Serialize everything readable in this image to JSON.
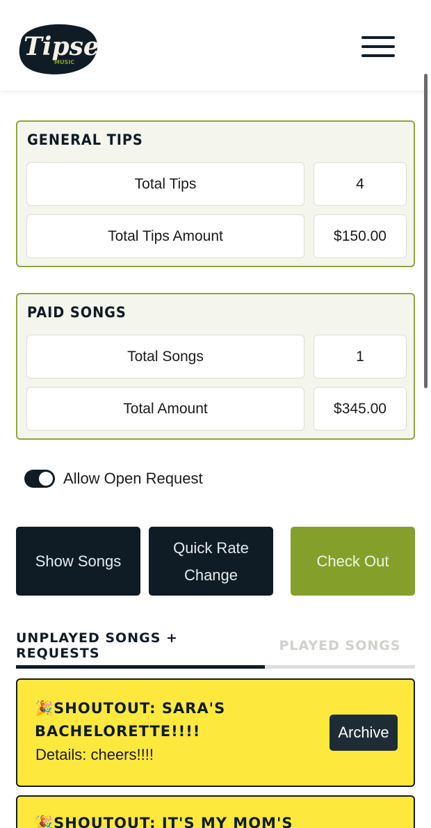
{
  "header": {
    "logo_text": "Tipsee",
    "logo_subtext": "MUSIC",
    "menu_icon": "hamburger-menu-icon"
  },
  "general_tips": {
    "title": "GENERAL TIPS",
    "rows": [
      {
        "label": "Total Tips",
        "value": "4"
      },
      {
        "label": "Total Tips Amount",
        "value": "$150.00"
      }
    ]
  },
  "paid_songs": {
    "title": "PAID SONGS",
    "rows": [
      {
        "label": "Total Songs",
        "value": "1"
      },
      {
        "label": "Total Amount",
        "value": "$345.00"
      }
    ]
  },
  "open_request": {
    "label": "Allow Open Request",
    "enabled": true
  },
  "actions": {
    "show_songs": "Show Songs",
    "quick_rate_line1": "Quick Rate",
    "quick_rate_line2": "Change",
    "check_out": "Check Out"
  },
  "tabs": {
    "unplayed": "UNPLAYED SONGS + REQUESTS",
    "played": "PLAYED SONGS"
  },
  "requests": [
    {
      "emoji": "🎉",
      "title_line1": "SHOUTOUT: SARA'S",
      "title_line2": "BACHELORETTE!!!!",
      "details": "Details: cheers!!!!",
      "archive_label": "Archive"
    },
    {
      "emoji": "🎉",
      "title_line1": "SHOUTOUT: IT'S MY MOM'S"
    }
  ],
  "colors": {
    "navy": "#0f1c26",
    "green": "#84a02a",
    "panel_bg": "#f4f5ec",
    "card_yellow": "#fde83e"
  }
}
